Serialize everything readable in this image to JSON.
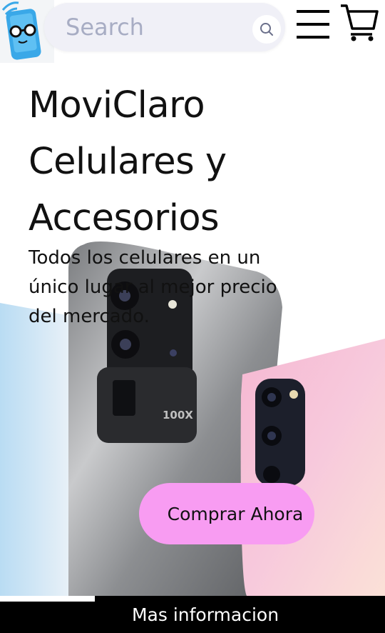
{
  "header": {
    "logo_name": "phone-nerd-logo",
    "search": {
      "placeholder": "Search",
      "value": ""
    },
    "search_icon": "search-icon",
    "menu_icon": "hamburger-menu-icon",
    "cart_icon": "shopping-cart-icon"
  },
  "hero": {
    "title_line1": "MoviClaro",
    "title_line2": "Celulares y",
    "title_line3": "Accesorios",
    "subtitle": "Todos los celulares en un único lugar al mejor precio del mercado.",
    "cta_label": "Comprar Ahora"
  },
  "footer": {
    "info_label": "Mas informacion"
  },
  "colors": {
    "cta_background": "#f89cf2",
    "search_background": "#f0f0f7",
    "logo_blue": "#3aa8e8",
    "footer_background": "#000000"
  }
}
